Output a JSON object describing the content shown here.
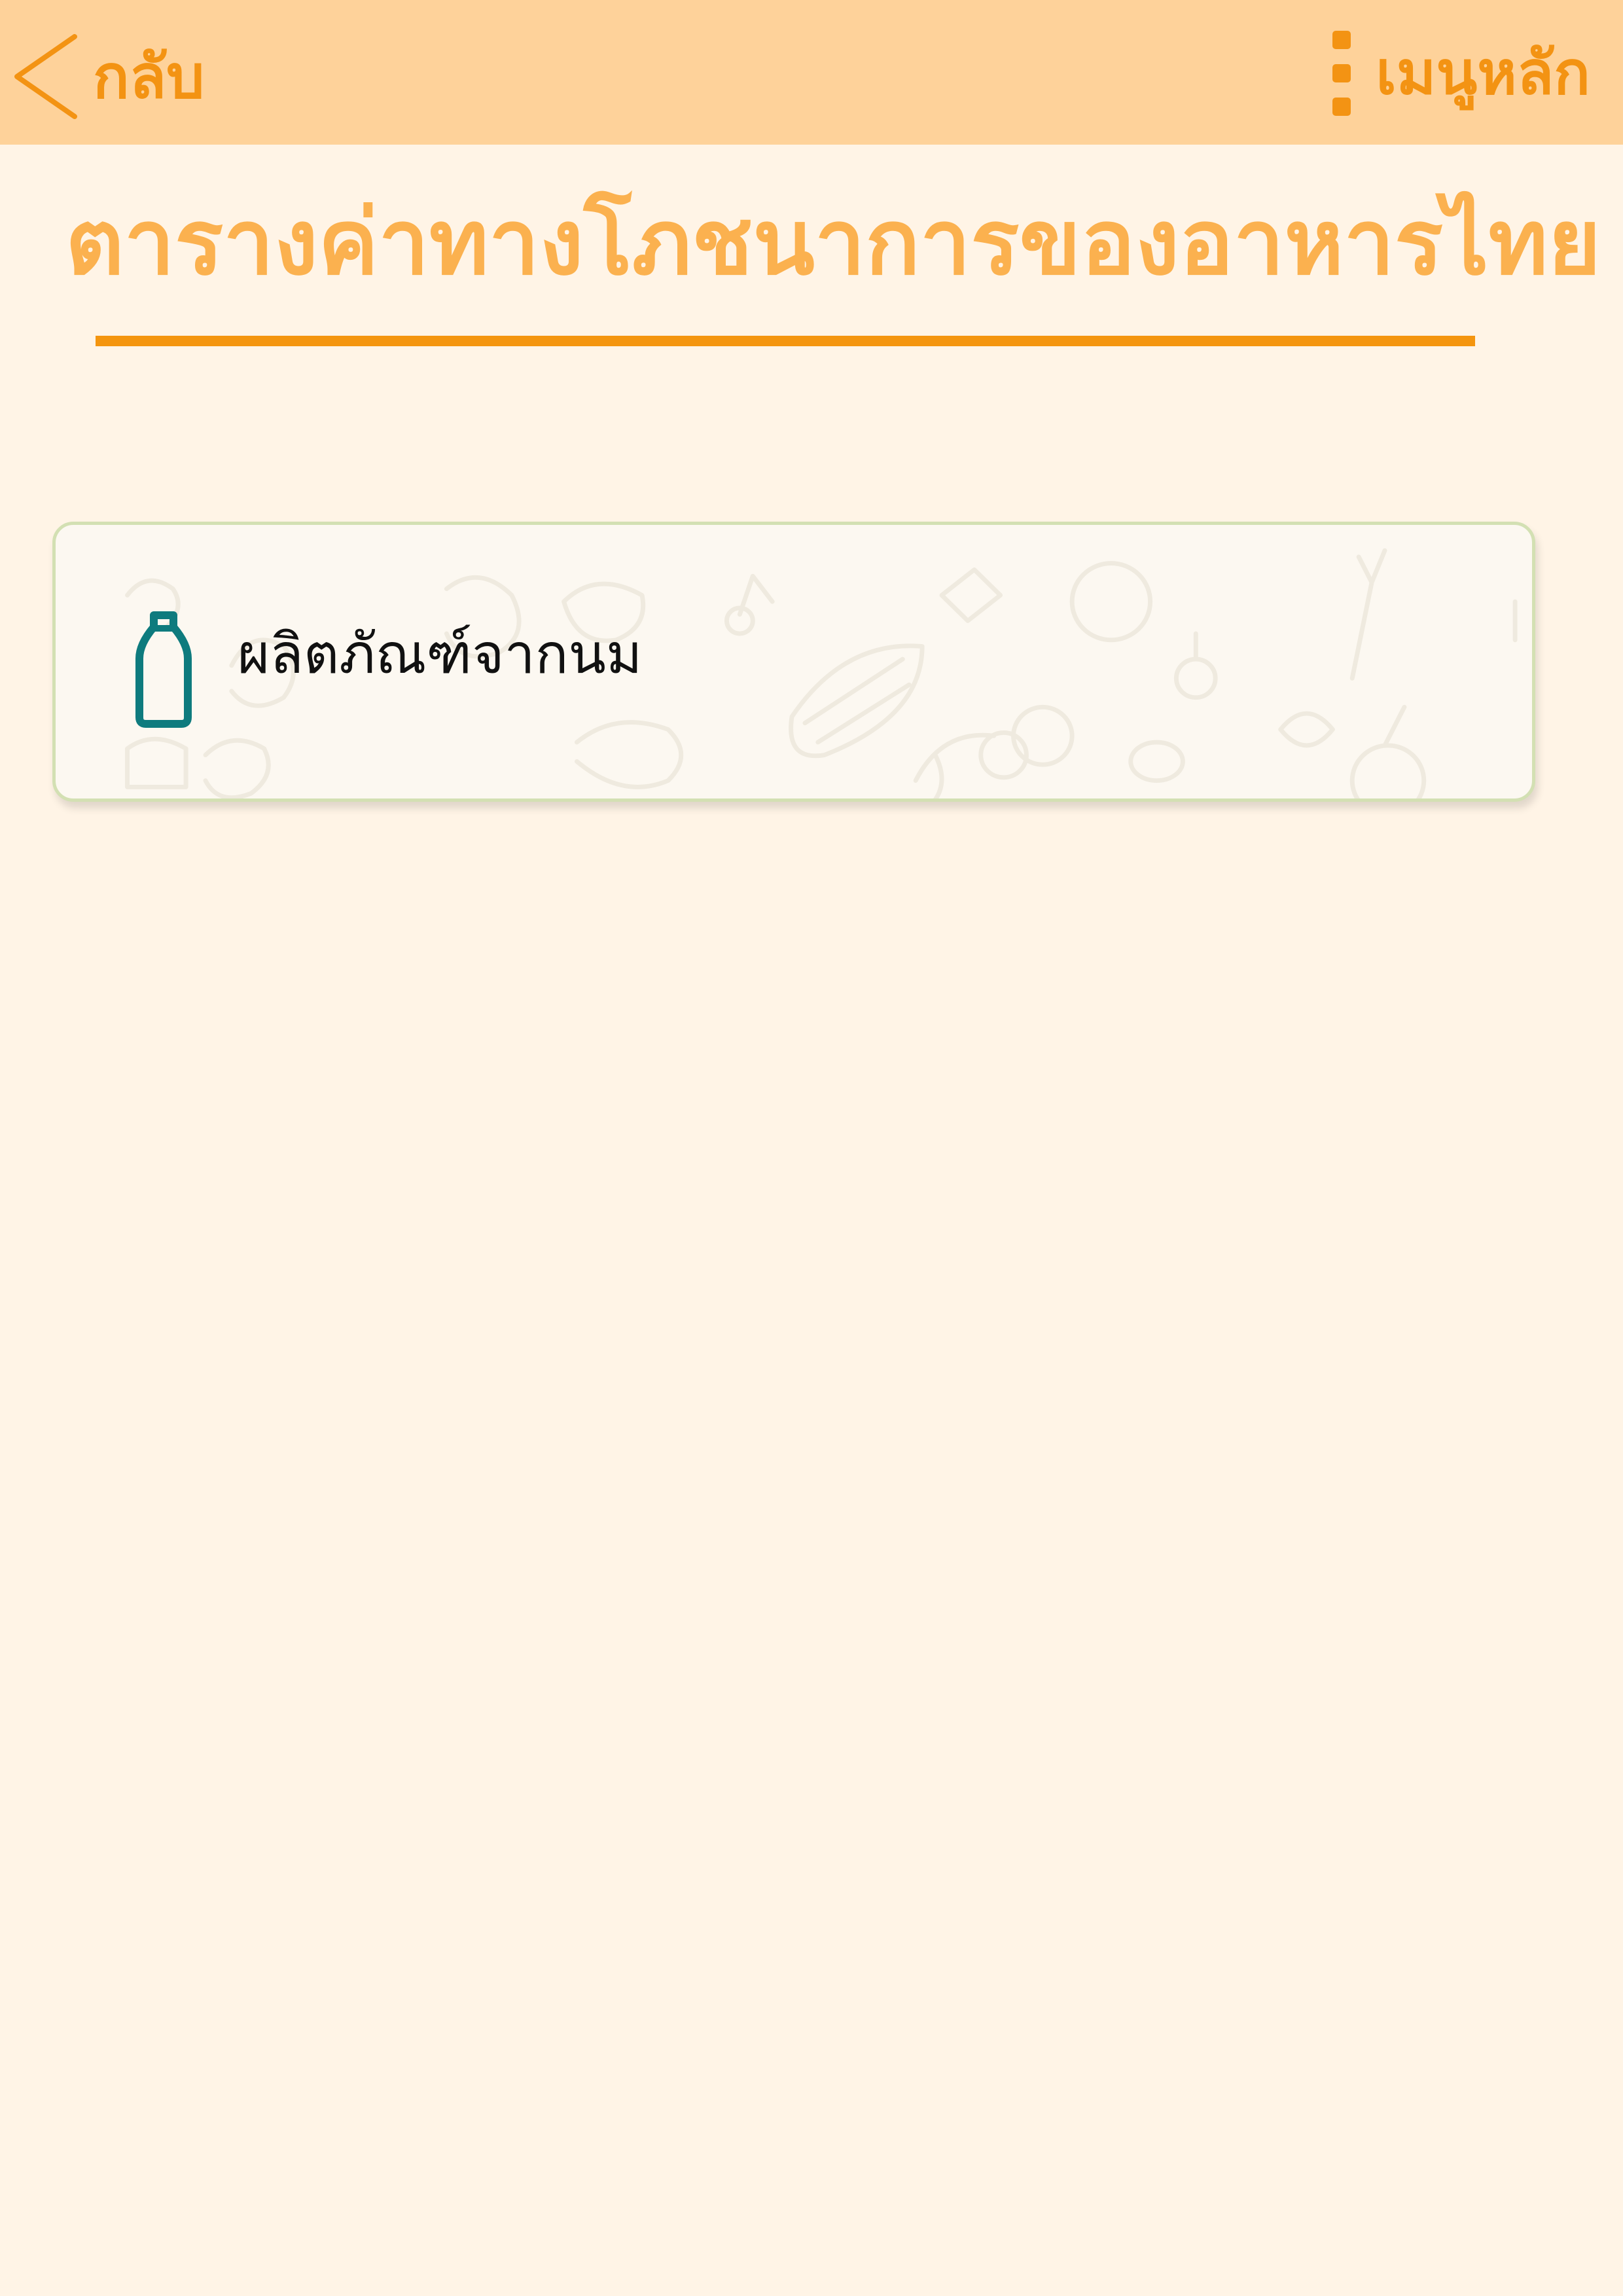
{
  "header": {
    "back_label": "กลับ",
    "back_icon": "chevron-left-icon",
    "menu_label": "เมนูหลัก",
    "menu_icon": "kebab-menu-icon",
    "accent_color": "#f39313",
    "bar_color": "#fed29a"
  },
  "page": {
    "title": "ตารางค่าทางโภชนาการของอาหารไทย",
    "title_color": "#fbb14f",
    "background_color": "#fff4e6"
  },
  "categories": [
    {
      "label": "ผลิตภัณฑ์จากนม",
      "icon": "milk-bottle-icon",
      "icon_color": "#0e7b7e"
    }
  ]
}
